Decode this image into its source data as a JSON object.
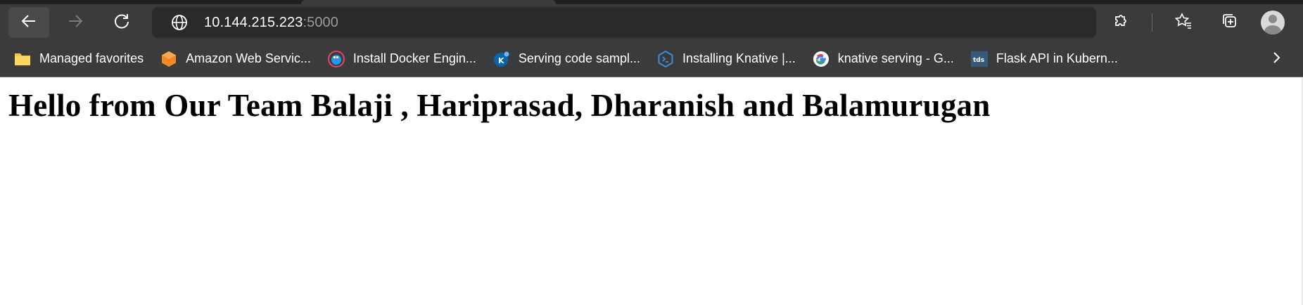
{
  "browser": {
    "address": {
      "host": "10.144.215.223",
      "port": ":5000"
    },
    "bookmarks": [
      {
        "label": "Managed favorites",
        "icon": "folder-icon"
      },
      {
        "label": "Amazon Web Servic...",
        "icon": "aws-icon"
      },
      {
        "label": "Install Docker Engin...",
        "icon": "docker-icon"
      },
      {
        "label": "Serving code sampl...",
        "icon": "knative-icon"
      },
      {
        "label": "Installing Knative |...",
        "icon": "terminal-icon"
      },
      {
        "label": "knative serving - G...",
        "icon": "google-icon"
      },
      {
        "label": "Flask API in Kubern...",
        "icon": "tds-icon",
        "icon_text": "tds"
      }
    ]
  },
  "page": {
    "heading": "Hello from Our Team Balaji , Hariprasad, Dharanish and Balamurugan"
  },
  "colors": {
    "chrome_background": "#3b3b3b",
    "address_bar": "#2a2a2a",
    "page_background": "#ffffff"
  }
}
